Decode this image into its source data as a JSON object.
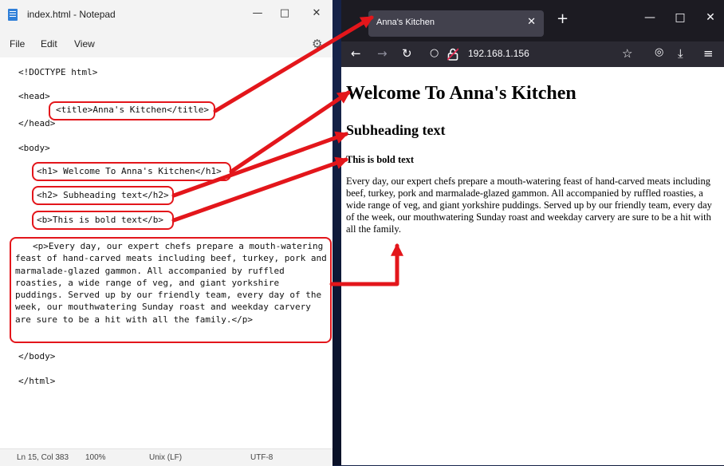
{
  "notepad": {
    "title": "index.html - Notepad",
    "menu": [
      "File",
      "Edit",
      "View"
    ],
    "code": {
      "doctype": "<!DOCTYPE html>",
      "head_open": "<head>",
      "title_line": "<title>Anna's Kitchen</title>",
      "head_close": "</head>",
      "body_open": "<body>",
      "h1_line": "<h1> Welcome To Anna's Kitchen</h1>",
      "h2_line": "<h2> Subheading text</h2>",
      "b_line": "<b>This is bold text</b>",
      "p_line": "<p>Every day, our expert chefs prepare a mouth-watering feast of hand-carved meats including beef, turkey, pork and marmalade-glazed gammon. All accompanied by ruffled roasties, a wide range of veg, and  giant yorkshire puddings.   Served up by our friendly team, every day of the week, our mouthwatering Sunday roast and weekday carvery are sure to be a hit with all the family.</p>",
      "body_close": "</body>",
      "html_close": "</html>"
    },
    "status": {
      "position": "Ln 15, Col 383",
      "zoom": "100%",
      "line_ending": "Unix (LF)",
      "encoding": "UTF-8"
    }
  },
  "browser": {
    "tab_title": "Anna's Kitchen",
    "url": "192.168.1.156",
    "page": {
      "h1": "Welcome To Anna's Kitchen",
      "h2": "Subheading text",
      "bold": "This is bold text",
      "paragraph": "Every day, our expert chefs prepare a mouth-watering feast of hand-carved meats including beef, turkey, pork and marmalade-glazed gammon. All accompanied by ruffled roasties, a wide range of veg, and giant yorkshire puddings. Served up by our friendly team, every day of the week, our mouthwatering Sunday roast and weekday carvery are sure to be a hit with all the family."
    }
  },
  "colors": {
    "highlight": "#e3161b",
    "browser_chrome": "#1c1b22",
    "notepad_chrome": "#f3f3f3"
  }
}
